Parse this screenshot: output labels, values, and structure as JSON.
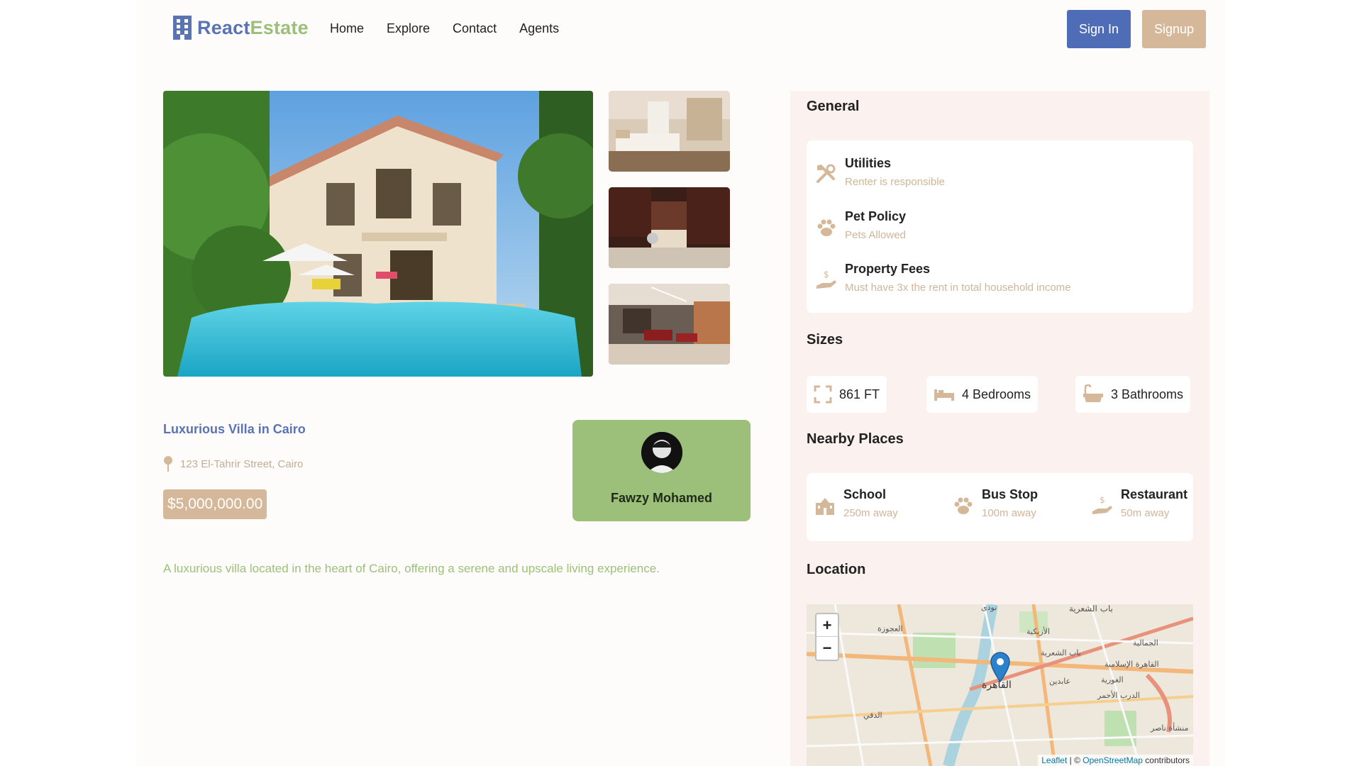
{
  "header": {
    "logo_react": "React",
    "logo_estate": "Estate",
    "nav": [
      "Home",
      "Explore",
      "Contact",
      "Agents"
    ],
    "signin_label": "Sign In",
    "signup_label": "Signup"
  },
  "property": {
    "title": "Luxurious Villa in Cairo",
    "address": "123 El-Tahrir Street, Cairo",
    "price": "$5,000,000.00",
    "description": "A luxurious villa located in the heart of Cairo, offering a serene and upscale living experience."
  },
  "agent": {
    "name": "Fawzy Mohamed"
  },
  "general": {
    "title": "General",
    "items": [
      {
        "icon": "tools-icon",
        "title": "Utilities",
        "subtitle": "Renter is responsible"
      },
      {
        "icon": "paw-icon",
        "title": "Pet Policy",
        "subtitle": "Pets Allowed"
      },
      {
        "icon": "hand-dollar-icon",
        "title": "Property Fees",
        "subtitle": "Must have 3x the rent in total household income"
      }
    ]
  },
  "sizes": {
    "title": "Sizes",
    "items": [
      {
        "icon": "area-icon",
        "label": "861 FT"
      },
      {
        "icon": "bed-icon",
        "label": "4 Bedrooms"
      },
      {
        "icon": "bath-icon",
        "label": "3 Bathrooms"
      }
    ]
  },
  "nearby": {
    "title": "Nearby Places",
    "items": [
      {
        "icon": "school-icon",
        "title": "School",
        "distance": "250m away"
      },
      {
        "icon": "paw-icon",
        "title": "Bus Stop",
        "distance": "100m away"
      },
      {
        "icon": "hand-dollar-icon",
        "title": "Restaurant",
        "distance": "50m away"
      }
    ]
  },
  "location": {
    "title": "Location",
    "zoom_in": "+",
    "zoom_out": "−",
    "attribution_leaflet": "Leaflet",
    "attribution_sep": " | © ",
    "attribution_osm": "OpenStreetMap",
    "attribution_suffix": " contributors",
    "map_labels": [
      "نودى",
      "باب الشعرية",
      "العجوزة",
      "الأزبكية",
      "الجمالية",
      "باب الشعرية",
      "القاهرة الإسلامية",
      "القاهرة",
      "عابدين",
      "الدرب الأحمر",
      "الدقي",
      "منشأة ناصر",
      "الغورية"
    ]
  },
  "colors": {
    "primary": "#4f6db6",
    "secondary": "#d4b899",
    "accent_green": "#9cc07a",
    "panel_bg": "#fbf1ee",
    "muted_text": "#d1b597"
  }
}
